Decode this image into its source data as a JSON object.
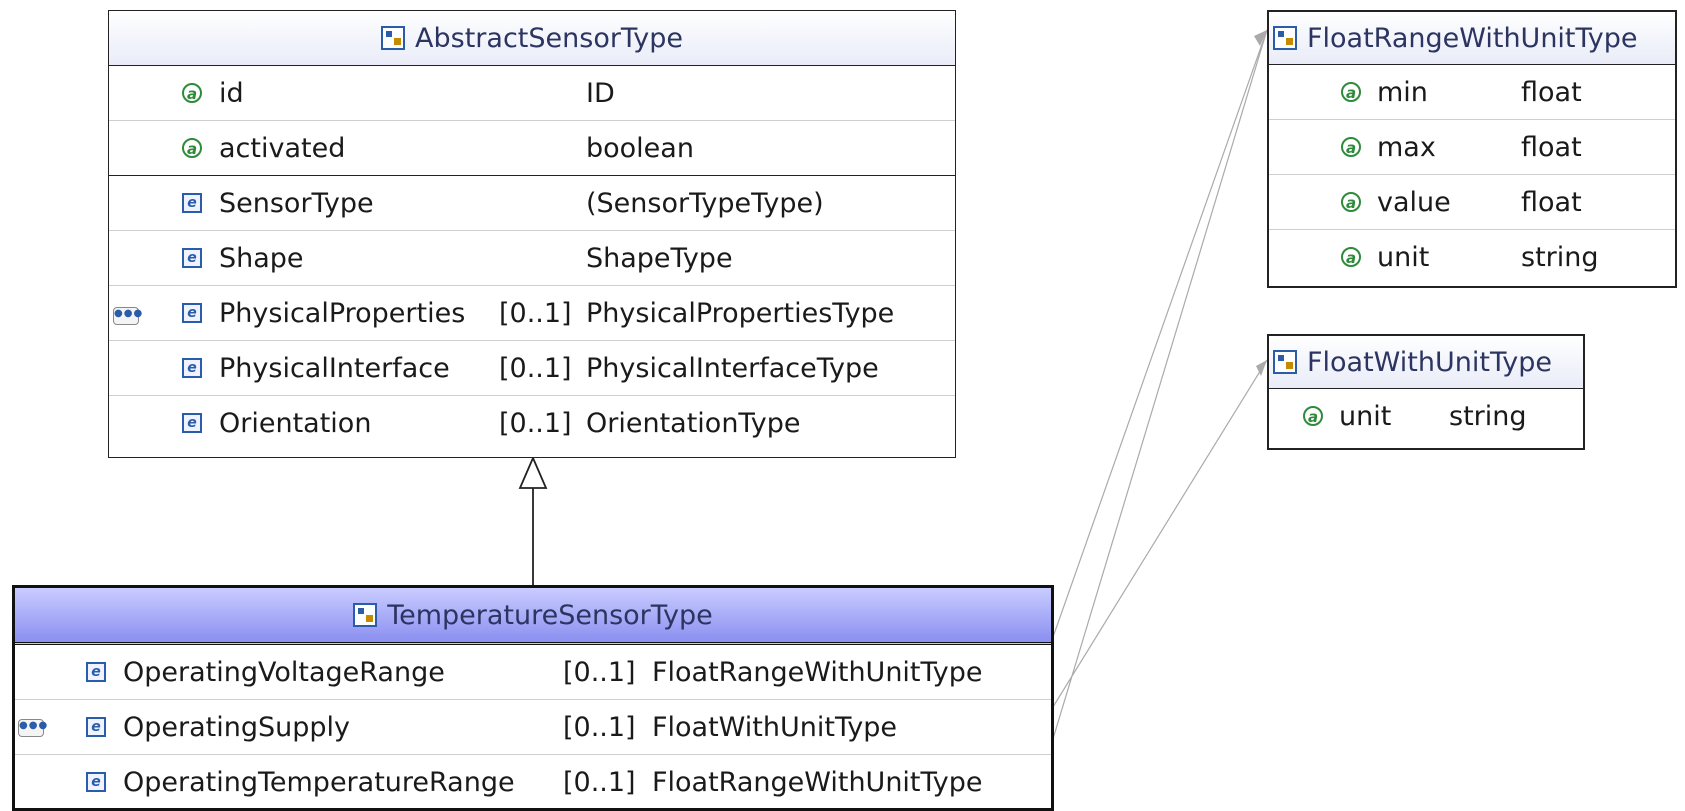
{
  "abstract": {
    "title": "AbstractSensorType",
    "attributes": [
      {
        "name": "id",
        "type": "ID"
      },
      {
        "name": "activated",
        "type": "boolean"
      }
    ],
    "elements": [
      {
        "name": "SensorType",
        "mult": "",
        "type": "(SensorTypeType)"
      },
      {
        "name": "Shape",
        "mult": "",
        "type": "ShapeType"
      },
      {
        "name": "PhysicalProperties",
        "mult": "[0..1]",
        "type": "PhysicalPropertiesType"
      },
      {
        "name": "PhysicalInterface",
        "mult": "[0..1]",
        "type": "PhysicalInterfaceType"
      },
      {
        "name": "Orientation",
        "mult": "[0..1]",
        "type": "OrientationType"
      }
    ]
  },
  "temperature": {
    "title": "TemperatureSensorType",
    "elements": [
      {
        "name": "OperatingVoltageRange",
        "mult": "[0..1]",
        "type": "FloatRangeWithUnitType"
      },
      {
        "name": "OperatingSupply",
        "mult": "[0..1]",
        "type": "FloatWithUnitType"
      },
      {
        "name": "OperatingTemperatureRange",
        "mult": "[0..1]",
        "type": "FloatRangeWithUnitType"
      }
    ]
  },
  "floatRange": {
    "title": "FloatRangeWithUnitType",
    "attributes": [
      {
        "name": "min",
        "type": "float"
      },
      {
        "name": "max",
        "type": "float"
      },
      {
        "name": "value",
        "type": "float"
      },
      {
        "name": "unit",
        "type": "string"
      }
    ]
  },
  "floatWith": {
    "title": "FloatWithUnitType",
    "attributes": [
      {
        "name": "unit",
        "type": "string"
      }
    ]
  },
  "icons": {
    "attribute": "attribute-icon",
    "element": "element-icon",
    "type": "complex-type-icon",
    "sequence": "sequence-icon"
  },
  "colors": {
    "attribute_icon": "#2e8b3a",
    "element_icon": "#2a5caa",
    "selected_header": "#8b8ff0"
  }
}
